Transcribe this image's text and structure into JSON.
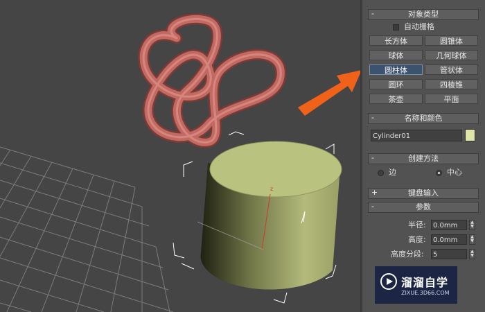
{
  "viewport": {
    "axis_label": "z",
    "colors": {
      "background": "#454545",
      "grid": "#8a8a8a",
      "knot": "#c26a62",
      "cylinder": "#b9c27e",
      "selection": "#ffffff",
      "arrow": "#f06219"
    }
  },
  "panel": {
    "object_type": {
      "header": "对象类型",
      "collapse_sign": "-",
      "auto_grid_label": "自动栅格",
      "buttons": [
        "长方体",
        "圆锥体",
        "球体",
        "几何球体",
        "圆柱体",
        "管状体",
        "圆环",
        "四棱锥",
        "茶壶",
        "平面"
      ],
      "active_button": "圆柱体"
    },
    "name_color": {
      "header": "名称和颜色",
      "collapse_sign": "-",
      "name_value": "Cylinder01",
      "color_swatch": "#dfe6a8"
    },
    "creation_method": {
      "header": "创建方法",
      "collapse_sign": "-",
      "options": [
        "边",
        "中心"
      ],
      "selected": "中心"
    },
    "keyboard_entry": {
      "header": "键盘输入",
      "collapse_sign": "+"
    },
    "parameters": {
      "header": "参数",
      "collapse_sign": "-",
      "radius_label": "半径:",
      "radius_value": "0.0mm",
      "height_label": "高度:",
      "height_value": "0.0mm",
      "height_segments_label": "高度分段:",
      "height_segments_value": "5"
    }
  },
  "watermark": {
    "title": "溜溜自学",
    "url": "ZIXUE.3D66.COM"
  }
}
